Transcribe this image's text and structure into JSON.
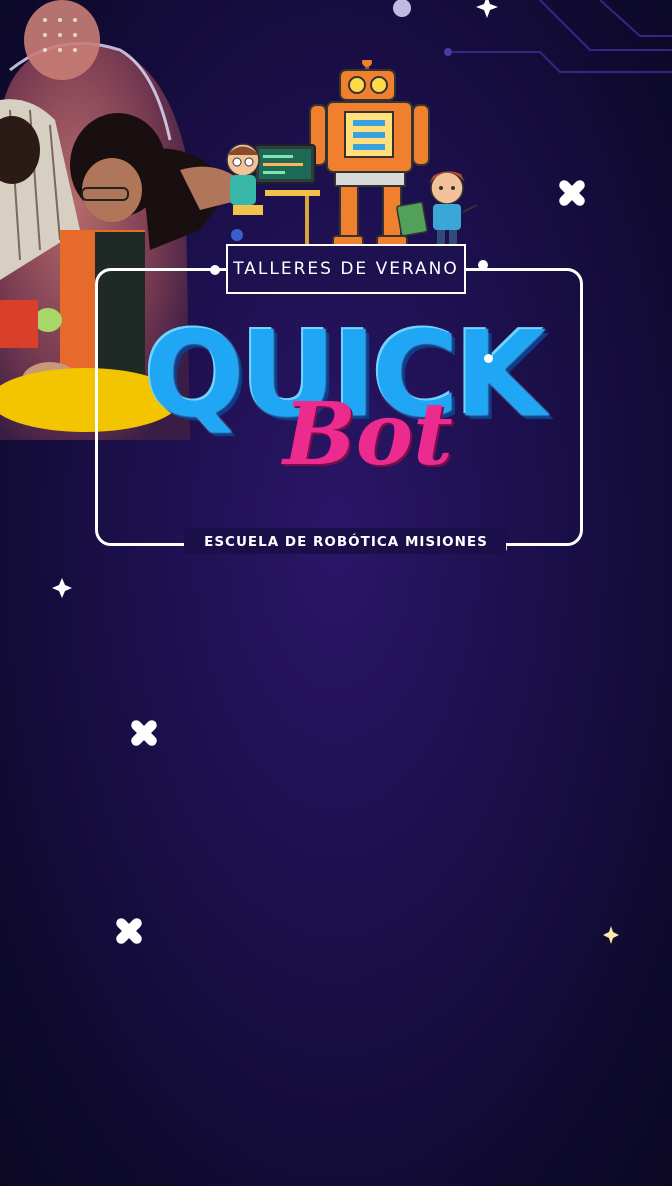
{
  "poster": {
    "workshop_label": "TALLERES DE VERANO",
    "brand_word_1": "QUICK",
    "brand_word_2": "Bot",
    "school_name": "ESCUELA DE ROBÓTICA MISIONES"
  },
  "colors": {
    "background": "#1b0f4a",
    "quick_blue": "#1fa7f5",
    "bot_pink": "#ec2b8f",
    "robot_orange": "#f07f2e",
    "frame": "#ffffff"
  },
  "icons": [
    "robot-illustration",
    "kid-at-computer-illustration",
    "kid-with-circuit-illustration",
    "sparkle-icon",
    "x-mark-icon",
    "circuit-lines"
  ]
}
